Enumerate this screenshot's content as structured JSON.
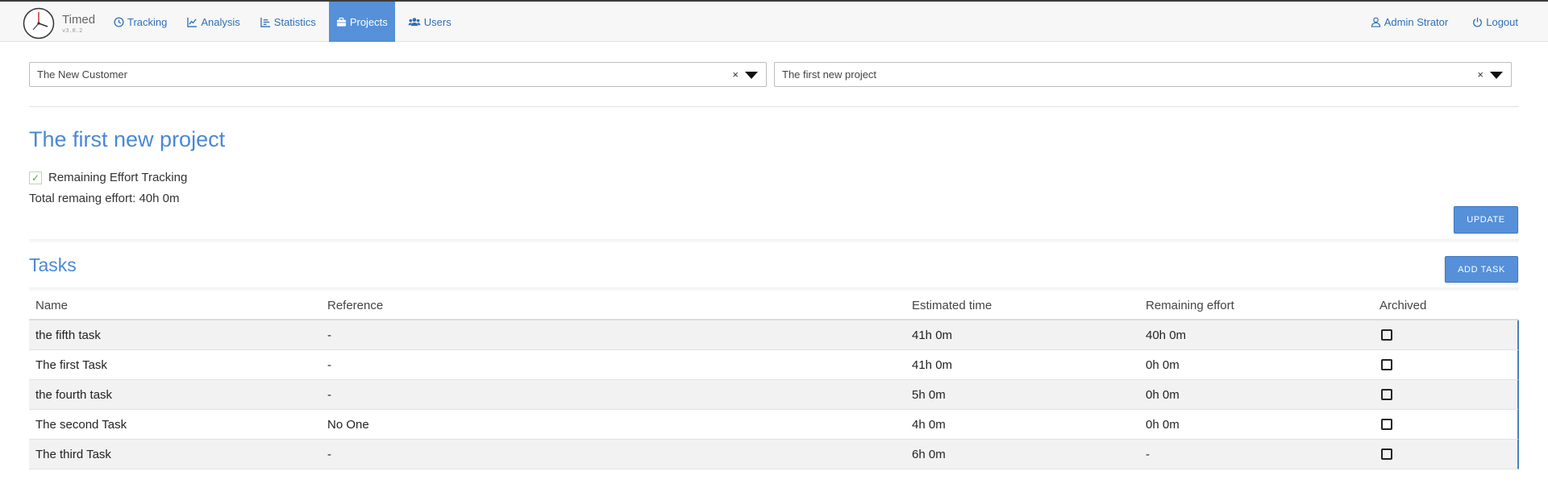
{
  "app": {
    "title": "Timed",
    "version": "v3.0.2"
  },
  "nav": {
    "items": [
      {
        "label": "Tracking",
        "icon": "clock-icon"
      },
      {
        "label": "Analysis",
        "icon": "line-chart-icon"
      },
      {
        "label": "Statistics",
        "icon": "bar-chart-icon"
      },
      {
        "label": "Projects",
        "icon": "briefcase-icon",
        "active": true
      },
      {
        "label": "Users",
        "icon": "users-icon"
      }
    ],
    "user": "Admin Strator",
    "logout": "Logout"
  },
  "filters": {
    "customer": "The New Customer",
    "project": "The first new project",
    "clear_symbol": "×"
  },
  "project": {
    "title": "The first new project",
    "remaining_effort_tracking_label": "Remaining Effort Tracking",
    "remaining_effort_tracking_checked": true,
    "total_remaining": "Total remaing effort: 40h 0m",
    "update_label": "UPDATE"
  },
  "tasks": {
    "title": "Tasks",
    "add_label": "ADD TASK",
    "columns": [
      "Name",
      "Reference",
      "Estimated time",
      "Remaining effort",
      "Archived"
    ],
    "rows": [
      {
        "name": "the fifth task",
        "reference": "-",
        "estimated": "41h 0m",
        "remaining": "40h 0m",
        "archived": false
      },
      {
        "name": "The first Task",
        "reference": "-",
        "estimated": "41h 0m",
        "remaining": "0h 0m",
        "archived": false
      },
      {
        "name": "the fourth task",
        "reference": "-",
        "estimated": "5h 0m",
        "remaining": "0h 0m",
        "archived": false
      },
      {
        "name": "The second Task",
        "reference": "No One",
        "estimated": "4h 0m",
        "remaining": "0h 0m",
        "archived": false
      },
      {
        "name": "The third Task",
        "reference": "-",
        "estimated": "6h 0m",
        "remaining": "-",
        "archived": false
      }
    ]
  },
  "colors": {
    "accent": "#5590d9",
    "title": "#4a88d6",
    "link": "#2f6fb7"
  }
}
